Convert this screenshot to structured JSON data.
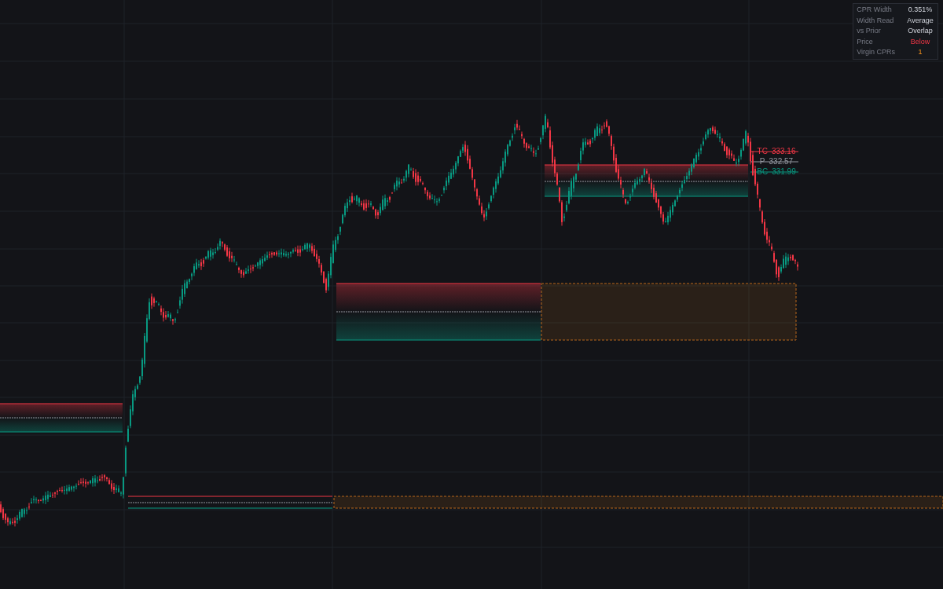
{
  "info_table": [
    {
      "label": "CPR Width",
      "value": "0.351%",
      "kind": "neutral"
    },
    {
      "label": "Width Read",
      "value": "Average",
      "kind": "neutral"
    },
    {
      "label": "vs Prior",
      "value": "Overlap",
      "kind": "neutral"
    },
    {
      "label": "Price",
      "value": "Below",
      "kind": "bearish"
    },
    {
      "label": "Virgin CPRs",
      "value": "1",
      "kind": "warning"
    }
  ],
  "cpr_labels": [
    {
      "name": "TC",
      "value": "333.16",
      "kind": "top"
    },
    {
      "name": "P",
      "value": "332.57",
      "kind": "pivot"
    },
    {
      "name": "BC",
      "value": "331.99",
      "kind": "bottom"
    }
  ]
}
